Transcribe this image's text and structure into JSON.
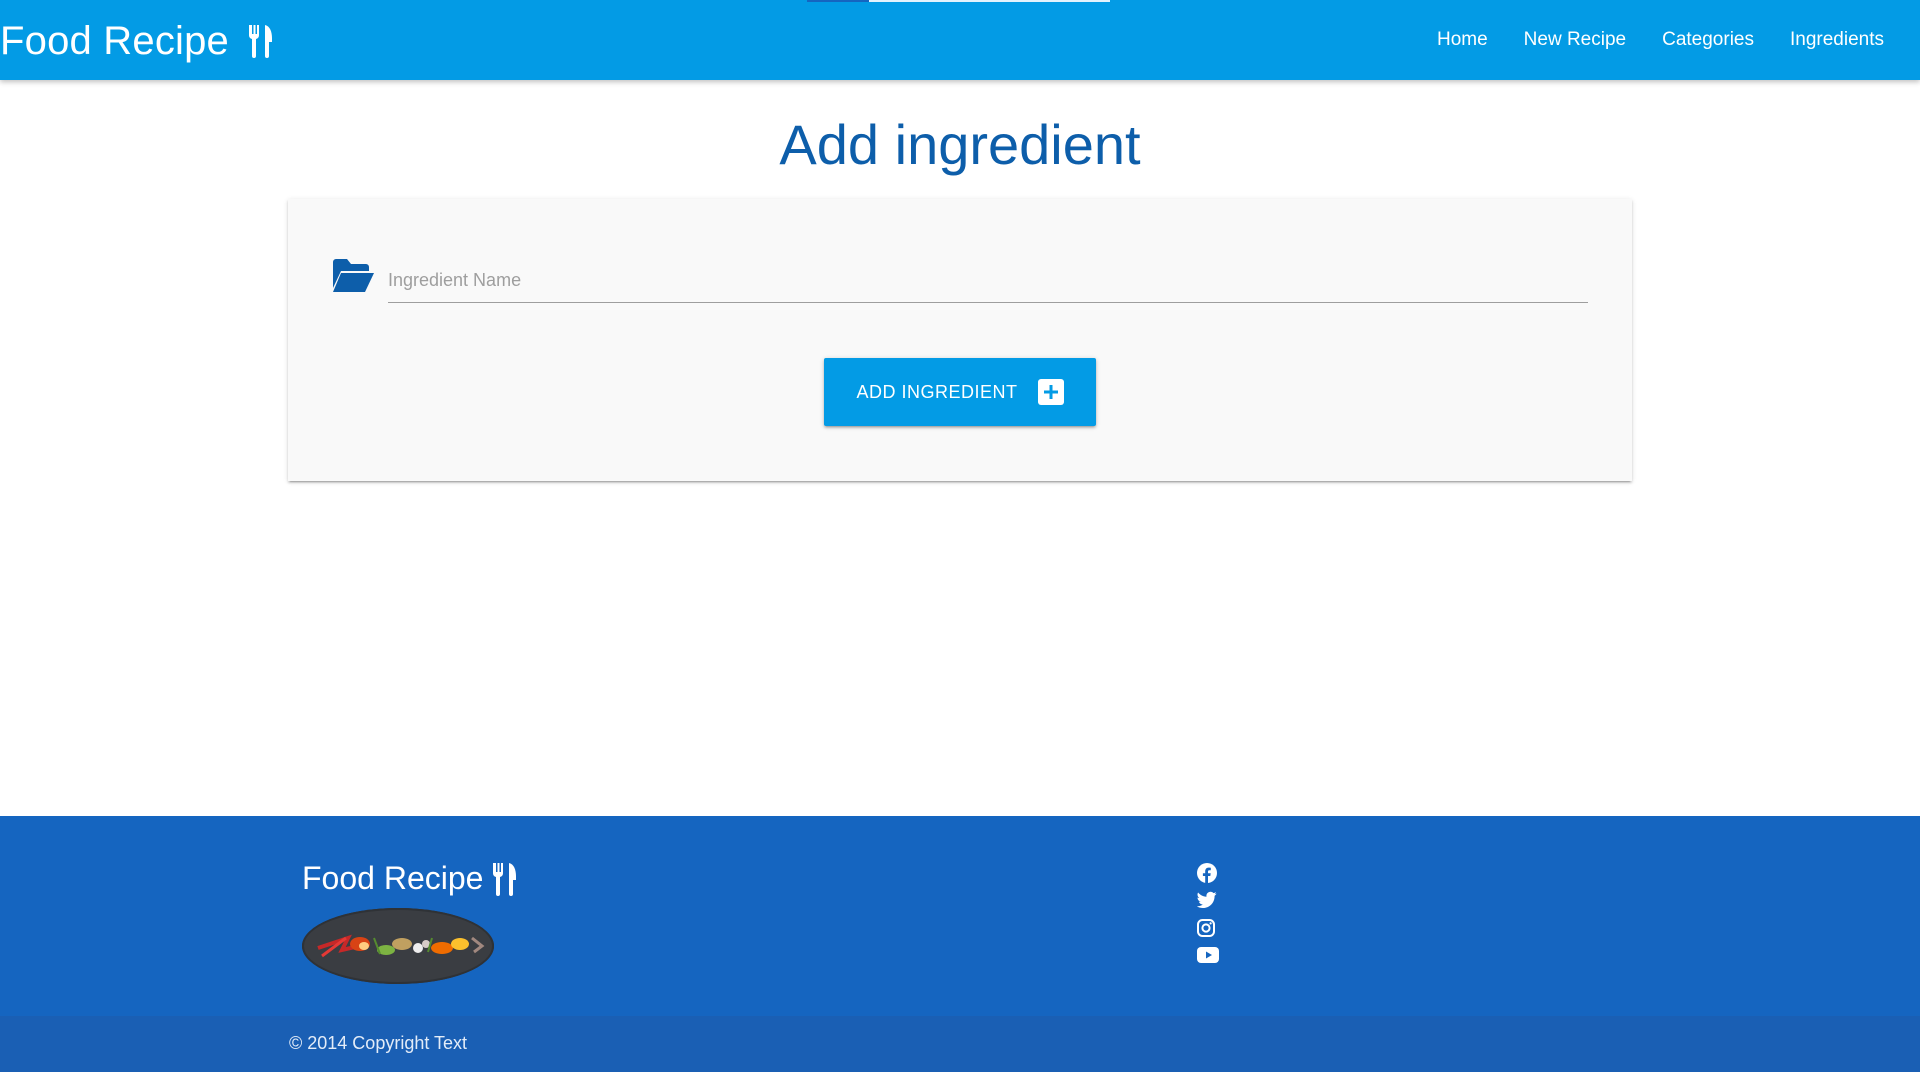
{
  "navbar": {
    "brand": "Food Recipe",
    "links": [
      "Home",
      "New Recipe",
      "Categories",
      "Ingredients"
    ]
  },
  "main": {
    "title": "Add ingredient",
    "form": {
      "input_placeholder": "Ingredient Name",
      "input_value": "",
      "submit_label": "ADD INGREDIENT"
    }
  },
  "footer": {
    "brand": "Food Recipe",
    "social_icons": [
      "facebook-icon",
      "twitter-icon",
      "instagram-icon",
      "youtube-icon"
    ],
    "copyright": "© 2014 Copyright Text"
  },
  "colors": {
    "navbar": "#039be5",
    "title": "#0d5eaa",
    "button": "#039be5",
    "footer": "#1565c0",
    "footer_bottom": "#1a5fb4"
  }
}
